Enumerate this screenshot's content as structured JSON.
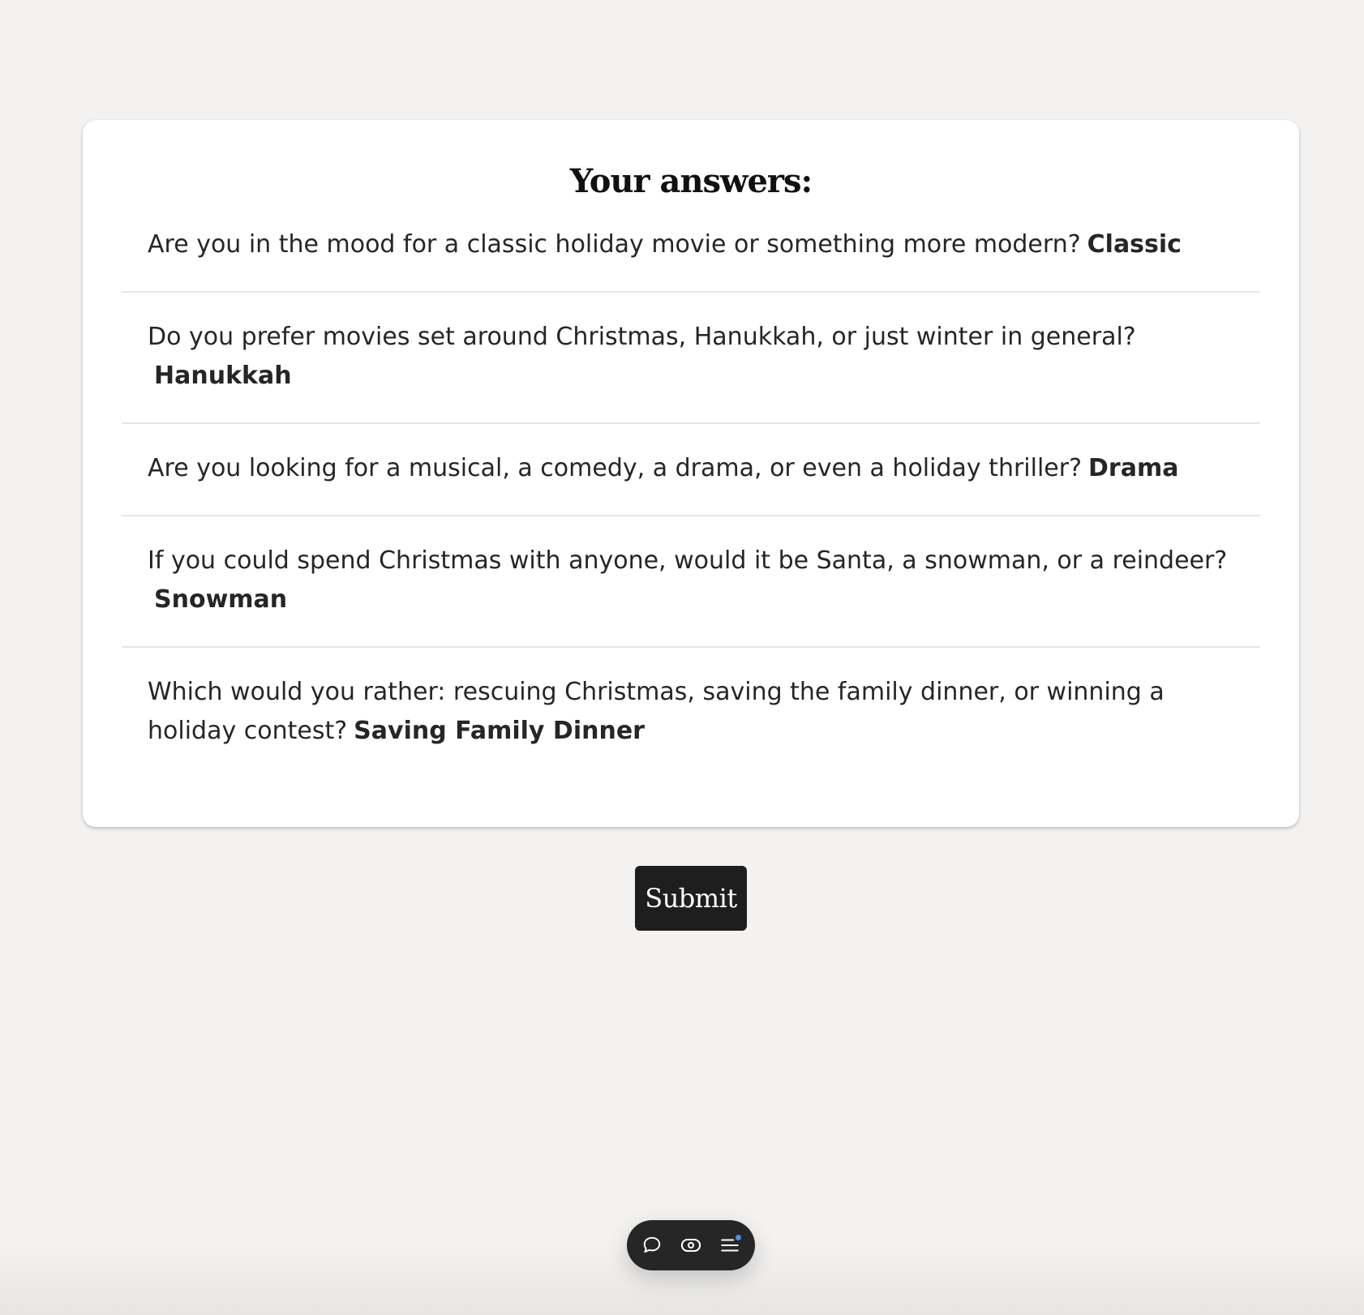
{
  "summary": {
    "title": "Your answers:",
    "answers": [
      {
        "question": "Are you in the mood for a classic holiday movie or something more modern?",
        "answer": "Classic"
      },
      {
        "question": "Do you prefer movies set around Christmas, Hanukkah, or just winter in general?",
        "answer": "Hanukkah"
      },
      {
        "question": "Are you looking for a musical, a comedy, a drama, or even a holiday thriller?",
        "answer": "Drama"
      },
      {
        "question": "If you could spend Christmas with anyone, would it be Santa, a snowman, or a reindeer?",
        "answer": "Snowman"
      },
      {
        "question": "Which would you rather: rescuing Christmas, saving the family dinner, or winning a holiday contest?",
        "answer": "Saving Family Dinner"
      }
    ]
  },
  "submit_label": "Submit",
  "toolbar": {
    "icons": [
      "chat-bubble-icon",
      "eye-icon",
      "menu-icon"
    ],
    "notification_color": "#4a90e8"
  },
  "colors": {
    "background": "#f3f2f1",
    "card": "#ffffff",
    "button": "#1e1e1e",
    "text": "#262626"
  }
}
